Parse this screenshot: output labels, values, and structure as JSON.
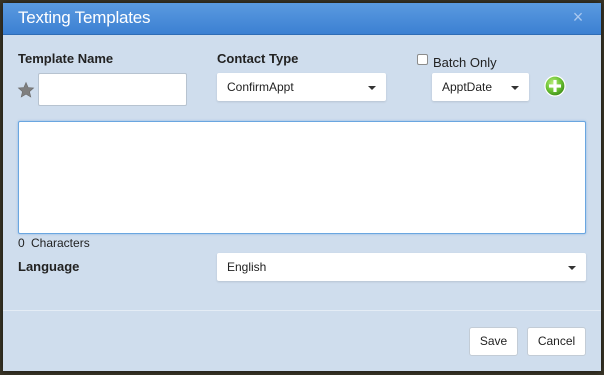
{
  "dialog": {
    "title": "Texting Templates",
    "close_symbol": "×",
    "close_icon": "close-icon"
  },
  "form": {
    "template_name_label": "Template Name",
    "template_name_value": "",
    "star_icon": "star-icon",
    "contact_type_label": "Contact Type",
    "contact_type_value": "ConfirmAppt",
    "batch_only_label": "Batch Only",
    "batch_only_checked": false,
    "merge_field_value": "ApptDate",
    "add_icon": "plus-circle-icon",
    "message_text": "",
    "char_count": "0",
    "characters_label": "Characters",
    "language_label": "Language",
    "language_value": "English"
  },
  "footer": {
    "save_label": "Save",
    "cancel_label": "Cancel"
  },
  "colors": {
    "titlebar": "#4a8ddb",
    "dialog_bg": "#cfdded",
    "add_green": "#66bb33"
  }
}
